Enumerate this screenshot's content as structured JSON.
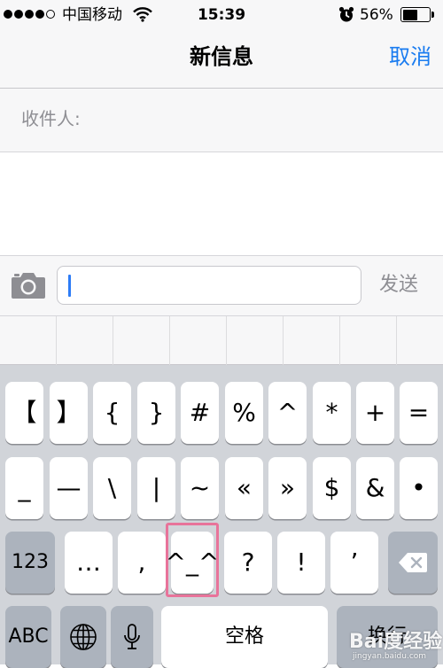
{
  "status_bar": {
    "carrier": "中国移动",
    "time": "15:39",
    "battery_percent": "56%",
    "battery_level": 0.56,
    "signal_bars_filled": 4,
    "signal_bars_total": 5,
    "icons": [
      "signal-dots",
      "wifi-icon",
      "alarm-icon",
      "battery-icon"
    ]
  },
  "nav": {
    "title": "新信息",
    "cancel_label": "取消",
    "accent_color": "#1a7cf0"
  },
  "recipient": {
    "label": "收件人:"
  },
  "compose": {
    "camera_icon": "camera-icon",
    "input_value": "",
    "send_label": "发送"
  },
  "keyboard": {
    "rows": [
      [
        "【",
        "】",
        "{",
        "}",
        "#",
        "%",
        "^",
        "*",
        "+",
        "="
      ],
      [
        "_",
        "—",
        "\\",
        "|",
        "~",
        "«",
        "»",
        "$",
        "&",
        "•"
      ],
      [
        "123",
        "…",
        ",",
        "^_^",
        "?",
        "!",
        "’"
      ],
      [
        "ABC",
        "空格",
        "换行"
      ]
    ],
    "mode_key": "123",
    "abc_key": "ABC",
    "space_label": "空格",
    "return_label": "换行",
    "highlighted_key": "^_^",
    "icons": [
      "globe-icon",
      "microphone-icon",
      "backspace-icon"
    ]
  },
  "watermark": {
    "logo": "Bai度经验",
    "url": "jingyan.baidu.com"
  }
}
